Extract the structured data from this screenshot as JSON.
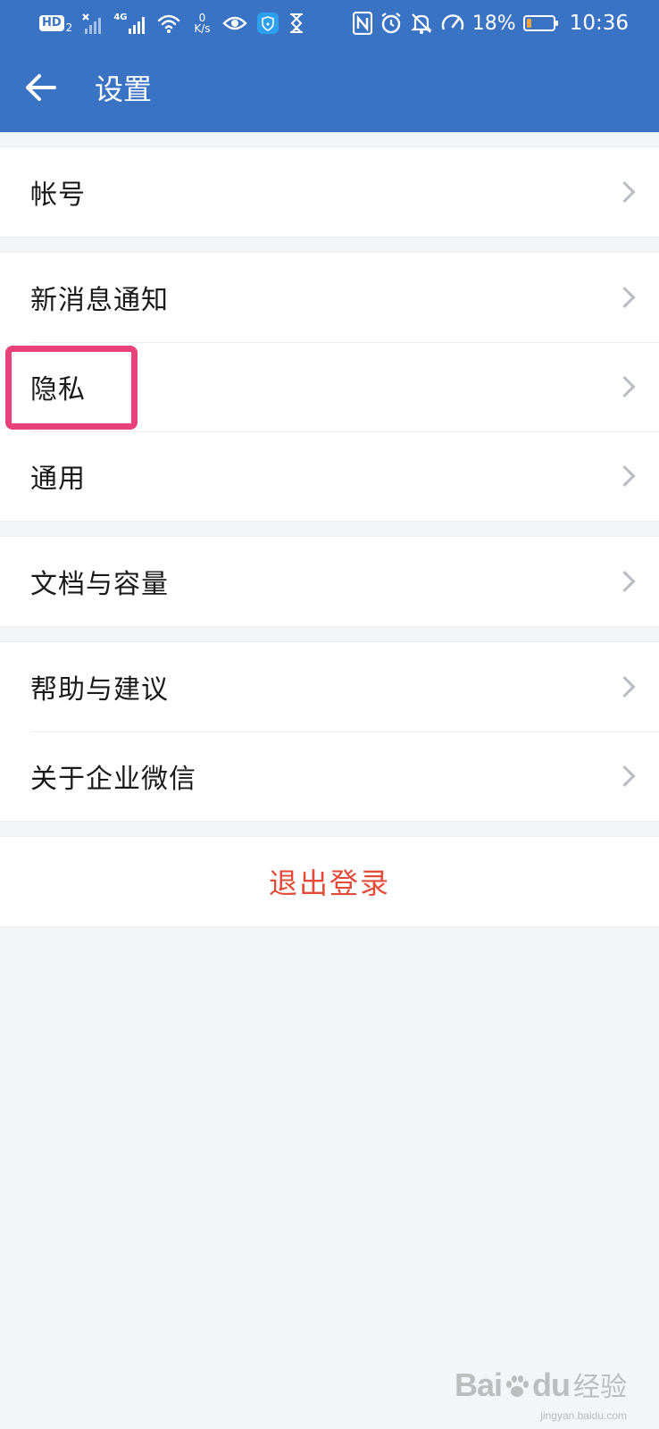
{
  "status_bar": {
    "hd_label": "HD",
    "hd_sub": "2",
    "network_type": "4G",
    "speed_value": "0",
    "speed_unit": "K/s",
    "battery_percent": "18%",
    "battery_level": 0.18,
    "time": "10:36",
    "icons": [
      "hd-icon",
      "no-signal-icon",
      "signal-4g-icon",
      "wifi-icon",
      "eye-icon",
      "shield-wifi-icon",
      "hourglass-icon",
      "nfc-icon",
      "alarm-icon",
      "mute-bell-icon",
      "speedometer-icon",
      "battery-icon"
    ]
  },
  "header": {
    "title": "设置",
    "back_icon": "arrow-left-icon"
  },
  "groups": [
    {
      "items": [
        {
          "label": "帐号"
        }
      ]
    },
    {
      "items": [
        {
          "label": "新消息通知"
        },
        {
          "label": "隐私",
          "highlighted": true
        },
        {
          "label": "通用"
        }
      ]
    },
    {
      "items": [
        {
          "label": "文档与容量"
        }
      ]
    },
    {
      "items": [
        {
          "label": "帮助与建议"
        },
        {
          "label": "关于企业微信"
        }
      ]
    }
  ],
  "logout": {
    "label": "退出登录"
  },
  "watermark": {
    "brand": "Bai",
    "brand_end": "du",
    "cn": "经验",
    "url": "jingyan.baidu.com"
  },
  "colors": {
    "appbar": "#3b73c4",
    "background": "#f3f5f8",
    "logout_text": "#e24b3a",
    "highlight_border": "#e7437a",
    "battery_fill": "#f3a33a"
  }
}
